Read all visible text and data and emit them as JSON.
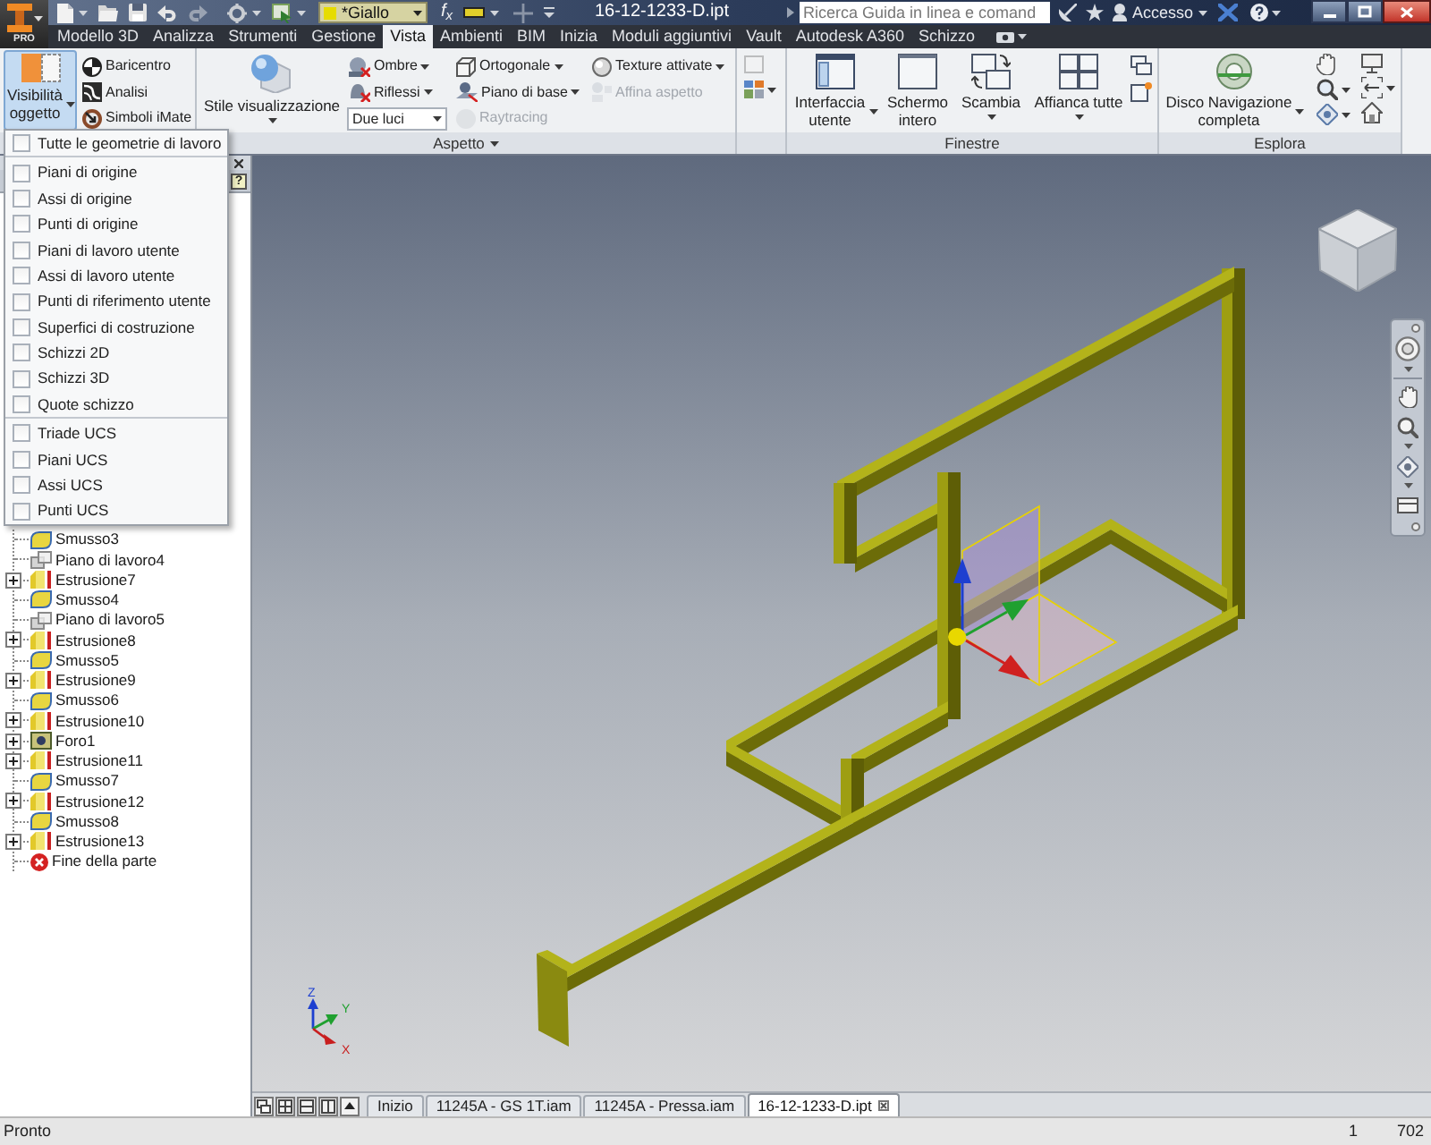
{
  "app_button": {
    "badge": "PRO"
  },
  "title_bar": {
    "style_dropdown": "*Giallo",
    "parameters": "f$_{x}$",
    "title": "16-12-1233-D.ipt",
    "search": {
      "placeholder": "Ricerca Guida in linea e comand"
    },
    "sign_in": "Accesso"
  },
  "menu_tabs": [
    {
      "label": "Modello 3D",
      "selected": false
    },
    {
      "label": "Analizza",
      "selected": false
    },
    {
      "label": "Strumenti",
      "selected": false
    },
    {
      "label": "Gestione",
      "selected": false
    },
    {
      "label": "Vista",
      "selected": true
    },
    {
      "label": "Ambienti",
      "selected": false
    },
    {
      "label": "BIM",
      "selected": false
    },
    {
      "label": "Inizia",
      "selected": false
    },
    {
      "label": "Moduli aggiuntivi",
      "selected": false
    },
    {
      "label": "Vault",
      "selected": false
    },
    {
      "label": "Autodesk A360",
      "selected": false
    },
    {
      "label": "Schizzo",
      "selected": false
    }
  ],
  "ribbon": {
    "visibility_panel": {
      "object_visibility": {
        "label": "Visibilità oggetto",
        "expanded": true
      },
      "tools": [
        {
          "kind": "center_of_gravity",
          "label": "Baricentro"
        },
        {
          "kind": "analysis",
          "label": "Analisi"
        },
        {
          "kind": "imate",
          "label": "Simboli iMate"
        }
      ]
    },
    "appearance_panel": {
      "title": "Aspetto",
      "visual_style": "Stile visualizzazione",
      "lighting": {
        "value": "Due luci"
      },
      "tools": [
        {
          "kind": "shadows",
          "label": "Ombre",
          "menu": true,
          "disabled": false
        },
        {
          "kind": "reflections",
          "label": "Riflessi",
          "menu": true,
          "disabled": false
        },
        {
          "kind": "projection",
          "label": "Ortogonale",
          "menu": true,
          "disabled": false
        },
        {
          "kind": "ground_plane",
          "label": "Piano di base",
          "menu": true,
          "disabled": false
        },
        {
          "kind": "ray_tracing",
          "label": "Raytracing",
          "menu": false,
          "disabled": true
        },
        {
          "kind": "textures",
          "label": "Texture attivate",
          "menu": true,
          "disabled": false
        },
        {
          "kind": "realism",
          "label": "Affina aspetto",
          "menu": false,
          "disabled": true
        }
      ]
    },
    "windows_panel": {
      "title": "Finestre",
      "buttons": [
        {
          "kind": "user_interface",
          "label": "Interfaccia utente"
        },
        {
          "kind": "full_screen",
          "label": "Schermo intero"
        },
        {
          "kind": "switch",
          "label": "Scambia"
        },
        {
          "kind": "tile",
          "label": "Affianca tutte"
        }
      ]
    },
    "navigate_panel": {
      "title": "Esplora",
      "wheel": {
        "label": "Disco Navigazione completa"
      }
    }
  },
  "visibility_menu": {
    "groups": [
      [
        {
          "label": "Tutte le geometrie di lavoro",
          "checked": false
        }
      ],
      [
        {
          "label": "Piani di origine",
          "checked": false
        },
        {
          "label": "Assi di origine",
          "checked": false
        },
        {
          "label": "Punti di origine",
          "checked": false
        },
        {
          "label": "Piani di lavoro utente",
          "checked": false
        },
        {
          "label": "Assi di lavoro utente",
          "checked": false
        },
        {
          "label": "Punti di riferimento utente",
          "checked": false
        },
        {
          "label": "Superfici di costruzione",
          "checked": false
        },
        {
          "label": "Schizzi 2D",
          "checked": false
        },
        {
          "label": "Schizzi 3D",
          "checked": false
        },
        {
          "label": "Quote schizzo",
          "checked": false
        }
      ],
      [
        {
          "label": "Triade UCS",
          "checked": false
        },
        {
          "label": "Piani UCS",
          "checked": false
        },
        {
          "label": "Assi UCS",
          "checked": false
        },
        {
          "label": "Punti UCS",
          "checked": false
        }
      ]
    ]
  },
  "browser": {
    "help": "?",
    "items": [
      {
        "kind": "fillet",
        "label": "Smusso3"
      },
      {
        "kind": "work_plane",
        "label": "Piano di lavoro4"
      },
      {
        "kind": "extrusion",
        "label": "Estrusione7",
        "expanded": false
      },
      {
        "kind": "fillet",
        "label": "Smusso4"
      },
      {
        "kind": "work_plane",
        "label": "Piano di lavoro5"
      },
      {
        "kind": "extrusion",
        "label": "Estrusione8",
        "expanded": false
      },
      {
        "kind": "fillet",
        "label": "Smusso5"
      },
      {
        "kind": "extrusion",
        "label": "Estrusione9",
        "expanded": false
      },
      {
        "kind": "fillet",
        "label": "Smusso6"
      },
      {
        "kind": "extrusion",
        "label": "Estrusione10",
        "expanded": false
      },
      {
        "kind": "hole",
        "label": "Foro1",
        "expanded": false
      },
      {
        "kind": "extrusion",
        "label": "Estrusione11",
        "expanded": false
      },
      {
        "kind": "fillet",
        "label": "Smusso7"
      },
      {
        "kind": "extrusion",
        "label": "Estrusione12",
        "expanded": false
      },
      {
        "kind": "fillet",
        "label": "Smusso8"
      },
      {
        "kind": "extrusion",
        "label": "Estrusione13",
        "expanded": false
      },
      {
        "kind": "end",
        "label": "Fine della parte"
      }
    ]
  },
  "viewport": {
    "triad": {
      "z": "Z",
      "y": "Y",
      "x": "X"
    }
  },
  "document_tabs": [
    {
      "label": "Inizio",
      "selected": false
    },
    {
      "label": "11245A - GS 1T.iam",
      "selected": false
    },
    {
      "label": "11245A - Pressa.iam",
      "selected": false
    },
    {
      "label": "16-12-1233-D.ipt",
      "selected": true
    }
  ],
  "status_bar": {
    "message": "Pronto",
    "fields": [
      "1",
      "702"
    ]
  }
}
